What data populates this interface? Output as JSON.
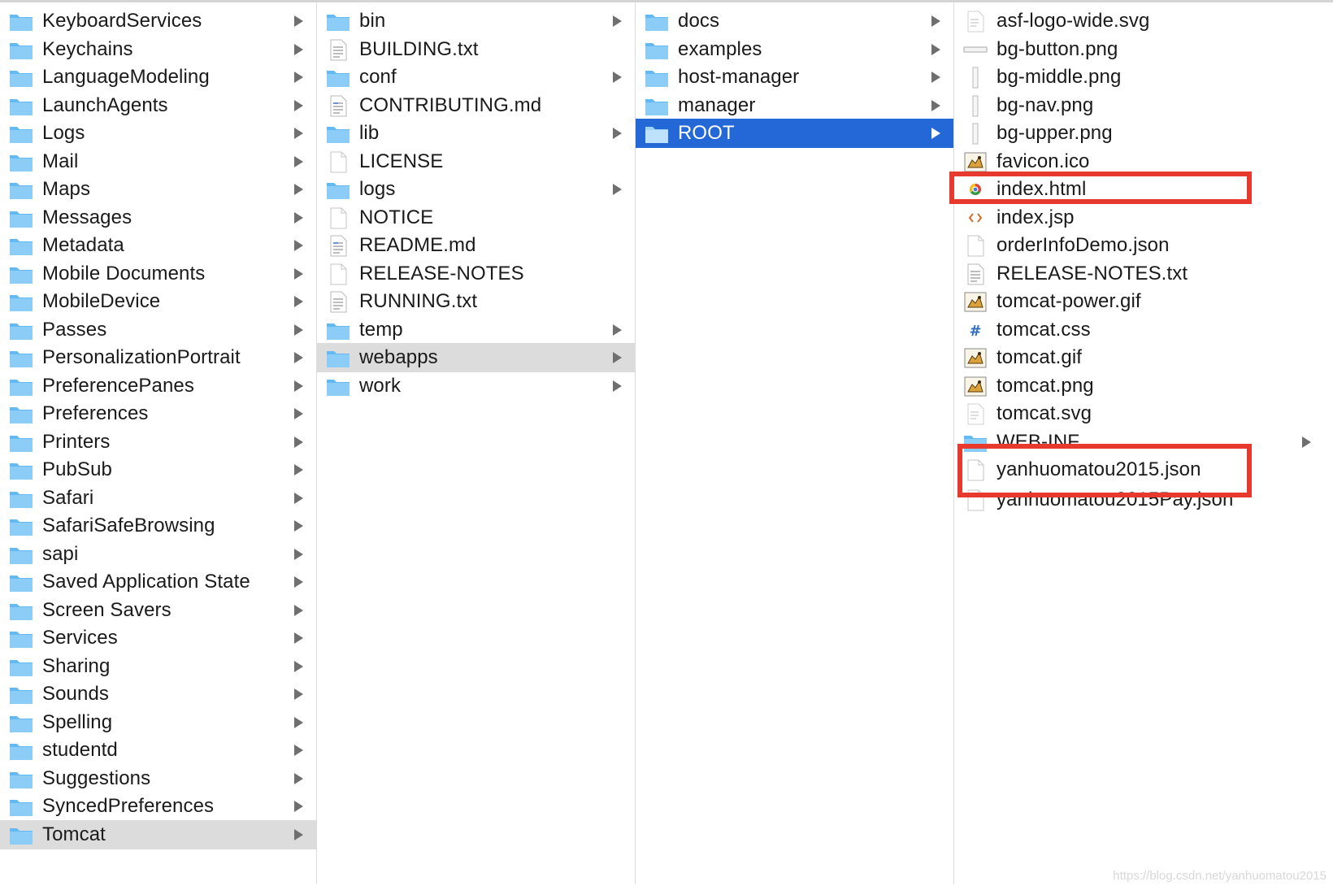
{
  "columns": [
    {
      "id": "library",
      "items": [
        {
          "name": "KeyboardServices",
          "kind": "folder",
          "expandable": true
        },
        {
          "name": "Keychains",
          "kind": "folder",
          "expandable": true
        },
        {
          "name": "LanguageModeling",
          "kind": "folder",
          "expandable": true
        },
        {
          "name": "LaunchAgents",
          "kind": "folder",
          "expandable": true
        },
        {
          "name": "Logs",
          "kind": "folder",
          "expandable": true
        },
        {
          "name": "Mail",
          "kind": "folder",
          "expandable": true
        },
        {
          "name": "Maps",
          "kind": "folder",
          "expandable": true
        },
        {
          "name": "Messages",
          "kind": "folder",
          "expandable": true
        },
        {
          "name": "Metadata",
          "kind": "folder",
          "expandable": true
        },
        {
          "name": "Mobile Documents",
          "kind": "folder",
          "expandable": true
        },
        {
          "name": "MobileDevice",
          "kind": "folder",
          "expandable": true
        },
        {
          "name": "Passes",
          "kind": "folder",
          "expandable": true
        },
        {
          "name": "PersonalizationPortrait",
          "kind": "folder",
          "expandable": true
        },
        {
          "name": "PreferencePanes",
          "kind": "folder",
          "expandable": true
        },
        {
          "name": "Preferences",
          "kind": "folder",
          "expandable": true
        },
        {
          "name": "Printers",
          "kind": "folder",
          "expandable": true
        },
        {
          "name": "PubSub",
          "kind": "folder",
          "expandable": true
        },
        {
          "name": "Safari",
          "kind": "folder",
          "expandable": true
        },
        {
          "name": "SafariSafeBrowsing",
          "kind": "folder",
          "expandable": true
        },
        {
          "name": "sapi",
          "kind": "folder",
          "expandable": true
        },
        {
          "name": "Saved Application State",
          "kind": "folder",
          "expandable": true
        },
        {
          "name": "Screen Savers",
          "kind": "folder",
          "expandable": true
        },
        {
          "name": "Services",
          "kind": "folder",
          "expandable": true
        },
        {
          "name": "Sharing",
          "kind": "folder",
          "expandable": true
        },
        {
          "name": "Sounds",
          "kind": "folder",
          "expandable": true
        },
        {
          "name": "Spelling",
          "kind": "folder",
          "expandable": true
        },
        {
          "name": "studentd",
          "kind": "folder",
          "expandable": true
        },
        {
          "name": "Suggestions",
          "kind": "folder",
          "expandable": true
        },
        {
          "name": "SyncedPreferences",
          "kind": "folder",
          "expandable": true
        },
        {
          "name": "Tomcat",
          "kind": "folder",
          "expandable": true,
          "selected": "gray"
        }
      ]
    },
    {
      "id": "tomcat",
      "items": [
        {
          "name": "bin",
          "kind": "folder",
          "expandable": true
        },
        {
          "name": "BUILDING.txt",
          "kind": "text-file"
        },
        {
          "name": "conf",
          "kind": "folder",
          "expandable": true
        },
        {
          "name": "CONTRIBUTING.md",
          "kind": "markdown-file"
        },
        {
          "name": "lib",
          "kind": "folder",
          "expandable": true
        },
        {
          "name": "LICENSE",
          "kind": "blank-file"
        },
        {
          "name": "logs",
          "kind": "folder",
          "expandable": true
        },
        {
          "name": "NOTICE",
          "kind": "blank-file"
        },
        {
          "name": "README.md",
          "kind": "markdown-file"
        },
        {
          "name": "RELEASE-NOTES",
          "kind": "blank-file"
        },
        {
          "name": "RUNNING.txt",
          "kind": "text-file"
        },
        {
          "name": "temp",
          "kind": "folder",
          "expandable": true
        },
        {
          "name": "webapps",
          "kind": "folder",
          "expandable": true,
          "selected": "gray"
        },
        {
          "name": "work",
          "kind": "folder",
          "expandable": true
        }
      ]
    },
    {
      "id": "webapps",
      "items": [
        {
          "name": "docs",
          "kind": "folder",
          "expandable": true
        },
        {
          "name": "examples",
          "kind": "folder",
          "expandable": true
        },
        {
          "name": "host-manager",
          "kind": "folder",
          "expandable": true
        },
        {
          "name": "manager",
          "kind": "folder",
          "expandable": true
        },
        {
          "name": "ROOT",
          "kind": "folder",
          "expandable": true,
          "selected": "blue"
        }
      ]
    },
    {
      "id": "root",
      "items": [
        {
          "name": "asf-logo-wide.svg",
          "kind": "svg-file"
        },
        {
          "name": "bg-button.png",
          "kind": "wide-image-file"
        },
        {
          "name": "bg-middle.png",
          "kind": "thin-image-file"
        },
        {
          "name": "bg-nav.png",
          "kind": "thin-image-file"
        },
        {
          "name": "bg-upper.png",
          "kind": "thin-image-file"
        },
        {
          "name": "favicon.ico",
          "kind": "cat-image-file"
        },
        {
          "name": "index.html",
          "kind": "chrome-html-file"
        },
        {
          "name": "index.jsp",
          "kind": "code-file"
        },
        {
          "name": "orderInfoDemo.json",
          "kind": "blank-file"
        },
        {
          "name": "RELEASE-NOTES.txt",
          "kind": "text-file"
        },
        {
          "name": "tomcat-power.gif",
          "kind": "cat-image-file"
        },
        {
          "name": "tomcat.css",
          "kind": "css-file"
        },
        {
          "name": "tomcat.gif",
          "kind": "cat-image-file"
        },
        {
          "name": "tomcat.png",
          "kind": "cat-image-file"
        },
        {
          "name": "tomcat.svg",
          "kind": "svg-file"
        },
        {
          "name": "WEB-INF",
          "kind": "folder",
          "expandable": true
        },
        {
          "name": "yanhuomatou2015.json",
          "kind": "blank-file"
        },
        {
          "name": "yanhuomatou2015Pay.json",
          "kind": "blank-file",
          "partially_hidden": true
        }
      ]
    }
  ],
  "watermark": "https://blog.csdn.net/yanhuomatou2015",
  "colors": {
    "selection_blue": "#2467d7",
    "selection_gray": "#dcdcdc",
    "folder_blue": "#5fb5f0",
    "annotation_red": "#e8392e"
  }
}
